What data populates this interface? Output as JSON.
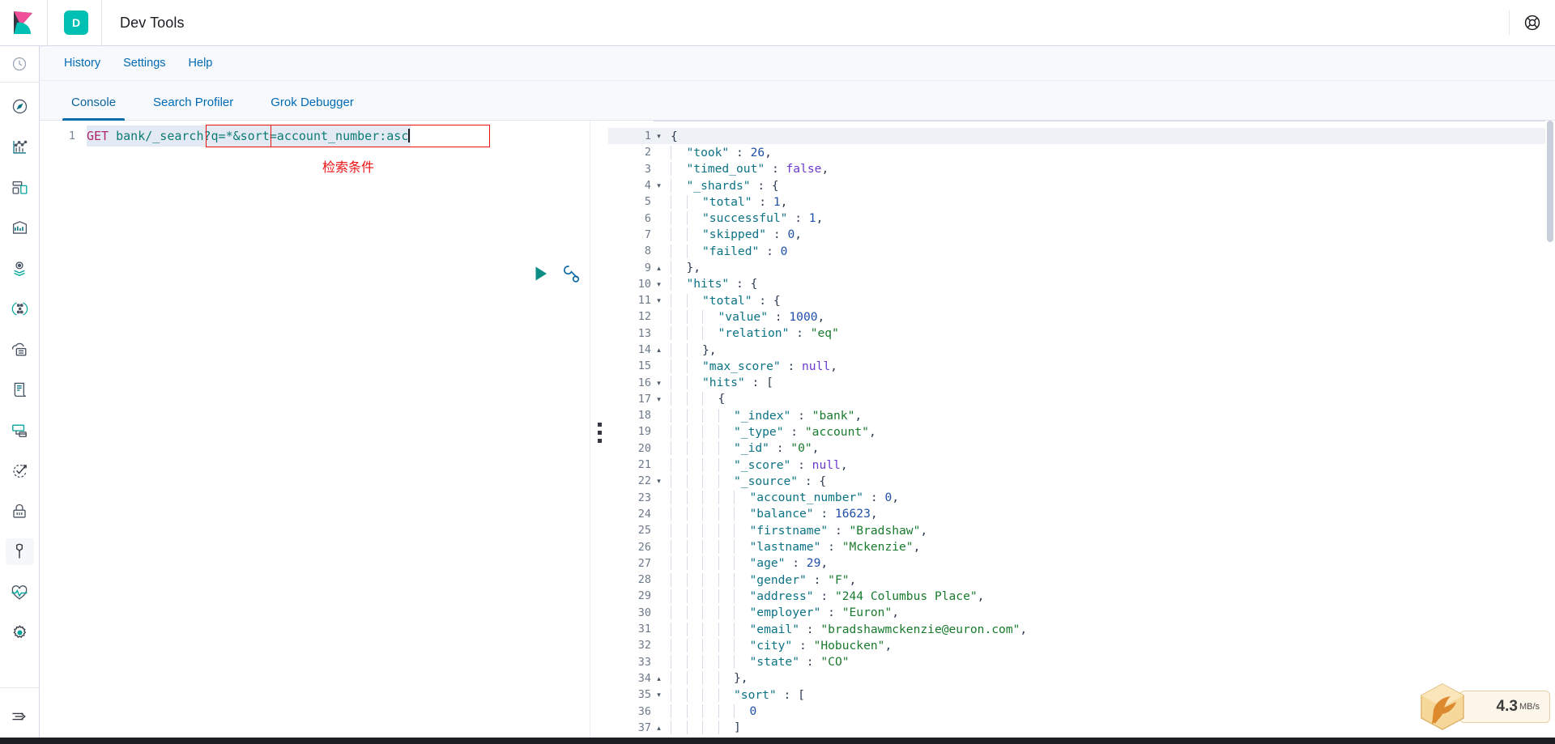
{
  "header": {
    "app_badge": "D",
    "title": "Dev Tools",
    "logo_name": "kibana-logo",
    "help_icon": "help-lifebuoy-icon"
  },
  "menu": {
    "items": [
      {
        "label": "History"
      },
      {
        "label": "Settings"
      },
      {
        "label": "Help"
      }
    ]
  },
  "tabs": {
    "items": [
      {
        "label": "Console",
        "active": true
      },
      {
        "label": "Search Profiler",
        "active": false
      },
      {
        "label": "Grok Debugger",
        "active": false
      }
    ]
  },
  "sidebar": {
    "items": [
      {
        "name": "recently-viewed-icon",
        "icon": "clock"
      },
      {
        "name": "discover-icon",
        "icon": "compass"
      },
      {
        "name": "visualize-icon",
        "icon": "chart"
      },
      {
        "name": "dashboard-icon",
        "icon": "dashboard"
      },
      {
        "name": "canvas-icon",
        "icon": "canvas"
      },
      {
        "name": "maps-icon",
        "icon": "map-pin-layers"
      },
      {
        "name": "graph-icon",
        "icon": "graph-nodes"
      },
      {
        "name": "machine-learning-icon",
        "icon": "ml-cloud"
      },
      {
        "name": "logs-icon",
        "icon": "logs-document"
      },
      {
        "name": "infrastructure-icon",
        "icon": "infrastructure"
      },
      {
        "name": "uptime-icon",
        "icon": "uptime-check"
      },
      {
        "name": "siem-icon",
        "icon": "lock"
      },
      {
        "name": "dev-tools-icon",
        "icon": "wrench",
        "active": true
      },
      {
        "name": "monitoring-icon",
        "icon": "heartbeat"
      },
      {
        "name": "management-icon",
        "icon": "gear"
      },
      {
        "name": "collapse-nav-icon",
        "icon": "arrow-collapse"
      }
    ]
  },
  "editor": {
    "line_number": "1",
    "method": "GET",
    "path_base": "bank",
    "path_search": "/_search",
    "query_string": "?q=*&sort=account_number:asc",
    "annotation_cn": "检索条件",
    "run_button_name": "send-request-play-button",
    "wrench_button_name": "request-options-wrench-button"
  },
  "output": {
    "lines": [
      {
        "no": "1",
        "fold": "▾",
        "indent": 0,
        "tokens": [
          [
            "p",
            "{"
          ]
        ]
      },
      {
        "no": "2",
        "fold": "",
        "indent": 1,
        "tokens": [
          [
            "k",
            "\"took\""
          ],
          [
            "p",
            " : "
          ],
          [
            "n",
            "26"
          ],
          [
            "p",
            ","
          ]
        ]
      },
      {
        "no": "3",
        "fold": "",
        "indent": 1,
        "tokens": [
          [
            "k",
            "\"timed_out\""
          ],
          [
            "p",
            " : "
          ],
          [
            "b",
            "false"
          ],
          [
            "p",
            ","
          ]
        ]
      },
      {
        "no": "4",
        "fold": "▾",
        "indent": 1,
        "tokens": [
          [
            "k",
            "\"_shards\""
          ],
          [
            "p",
            " : {"
          ]
        ]
      },
      {
        "no": "5",
        "fold": "",
        "indent": 2,
        "tokens": [
          [
            "k",
            "\"total\""
          ],
          [
            "p",
            " : "
          ],
          [
            "n",
            "1"
          ],
          [
            "p",
            ","
          ]
        ]
      },
      {
        "no": "6",
        "fold": "",
        "indent": 2,
        "tokens": [
          [
            "k",
            "\"successful\""
          ],
          [
            "p",
            " : "
          ],
          [
            "n",
            "1"
          ],
          [
            "p",
            ","
          ]
        ]
      },
      {
        "no": "7",
        "fold": "",
        "indent": 2,
        "tokens": [
          [
            "k",
            "\"skipped\""
          ],
          [
            "p",
            " : "
          ],
          [
            "n",
            "0"
          ],
          [
            "p",
            ","
          ]
        ]
      },
      {
        "no": "8",
        "fold": "",
        "indent": 2,
        "tokens": [
          [
            "k",
            "\"failed\""
          ],
          [
            "p",
            " : "
          ],
          [
            "n",
            "0"
          ]
        ]
      },
      {
        "no": "9",
        "fold": "▴",
        "indent": 1,
        "tokens": [
          [
            "p",
            "},"
          ]
        ]
      },
      {
        "no": "10",
        "fold": "▾",
        "indent": 1,
        "tokens": [
          [
            "k",
            "\"hits\""
          ],
          [
            "p",
            " : {"
          ]
        ]
      },
      {
        "no": "11",
        "fold": "▾",
        "indent": 2,
        "tokens": [
          [
            "k",
            "\"total\""
          ],
          [
            "p",
            " : {"
          ]
        ]
      },
      {
        "no": "12",
        "fold": "",
        "indent": 3,
        "tokens": [
          [
            "k",
            "\"value\""
          ],
          [
            "p",
            " : "
          ],
          [
            "n",
            "1000"
          ],
          [
            "p",
            ","
          ]
        ]
      },
      {
        "no": "13",
        "fold": "",
        "indent": 3,
        "tokens": [
          [
            "k",
            "\"relation\""
          ],
          [
            "p",
            " : "
          ],
          [
            "s",
            "\"eq\""
          ]
        ]
      },
      {
        "no": "14",
        "fold": "▴",
        "indent": 2,
        "tokens": [
          [
            "p",
            "},"
          ]
        ]
      },
      {
        "no": "15",
        "fold": "",
        "indent": 2,
        "tokens": [
          [
            "k",
            "\"max_score\""
          ],
          [
            "p",
            " : "
          ],
          [
            "b",
            "null"
          ],
          [
            "p",
            ","
          ]
        ]
      },
      {
        "no": "16",
        "fold": "▾",
        "indent": 2,
        "tokens": [
          [
            "k",
            "\"hits\""
          ],
          [
            "p",
            " : ["
          ]
        ]
      },
      {
        "no": "17",
        "fold": "▾",
        "indent": 3,
        "tokens": [
          [
            "p",
            "{"
          ]
        ]
      },
      {
        "no": "18",
        "fold": "",
        "indent": 4,
        "tokens": [
          [
            "k",
            "\"_index\""
          ],
          [
            "p",
            " : "
          ],
          [
            "s",
            "\"bank\""
          ],
          [
            "p",
            ","
          ]
        ]
      },
      {
        "no": "19",
        "fold": "",
        "indent": 4,
        "tokens": [
          [
            "k",
            "\"_type\""
          ],
          [
            "p",
            " : "
          ],
          [
            "s",
            "\"account\""
          ],
          [
            "p",
            ","
          ]
        ]
      },
      {
        "no": "20",
        "fold": "",
        "indent": 4,
        "tokens": [
          [
            "k",
            "\"_id\""
          ],
          [
            "p",
            " : "
          ],
          [
            "s",
            "\"0\""
          ],
          [
            "p",
            ","
          ]
        ]
      },
      {
        "no": "21",
        "fold": "",
        "indent": 4,
        "tokens": [
          [
            "k",
            "\"_score\""
          ],
          [
            "p",
            " : "
          ],
          [
            "b",
            "null"
          ],
          [
            "p",
            ","
          ]
        ]
      },
      {
        "no": "22",
        "fold": "▾",
        "indent": 4,
        "tokens": [
          [
            "k",
            "\"_source\""
          ],
          [
            "p",
            " : {"
          ]
        ]
      },
      {
        "no": "23",
        "fold": "",
        "indent": 5,
        "tokens": [
          [
            "k",
            "\"account_number\""
          ],
          [
            "p",
            " : "
          ],
          [
            "n",
            "0"
          ],
          [
            "p",
            ","
          ]
        ]
      },
      {
        "no": "24",
        "fold": "",
        "indent": 5,
        "tokens": [
          [
            "k",
            "\"balance\""
          ],
          [
            "p",
            " : "
          ],
          [
            "n",
            "16623"
          ],
          [
            "p",
            ","
          ]
        ]
      },
      {
        "no": "25",
        "fold": "",
        "indent": 5,
        "tokens": [
          [
            "k",
            "\"firstname\""
          ],
          [
            "p",
            " : "
          ],
          [
            "s",
            "\"Bradshaw\""
          ],
          [
            "p",
            ","
          ]
        ]
      },
      {
        "no": "26",
        "fold": "",
        "indent": 5,
        "tokens": [
          [
            "k",
            "\"lastname\""
          ],
          [
            "p",
            " : "
          ],
          [
            "s",
            "\"Mckenzie\""
          ],
          [
            "p",
            ","
          ]
        ]
      },
      {
        "no": "27",
        "fold": "",
        "indent": 5,
        "tokens": [
          [
            "k",
            "\"age\""
          ],
          [
            "p",
            " : "
          ],
          [
            "n",
            "29"
          ],
          [
            "p",
            ","
          ]
        ]
      },
      {
        "no": "28",
        "fold": "",
        "indent": 5,
        "tokens": [
          [
            "k",
            "\"gender\""
          ],
          [
            "p",
            " : "
          ],
          [
            "s",
            "\"F\""
          ],
          [
            "p",
            ","
          ]
        ]
      },
      {
        "no": "29",
        "fold": "",
        "indent": 5,
        "tokens": [
          [
            "k",
            "\"address\""
          ],
          [
            "p",
            " : "
          ],
          [
            "s",
            "\"244 Columbus Place\""
          ],
          [
            "p",
            ","
          ]
        ]
      },
      {
        "no": "30",
        "fold": "",
        "indent": 5,
        "tokens": [
          [
            "k",
            "\"employer\""
          ],
          [
            "p",
            " : "
          ],
          [
            "s",
            "\"Euron\""
          ],
          [
            "p",
            ","
          ]
        ]
      },
      {
        "no": "31",
        "fold": "",
        "indent": 5,
        "tokens": [
          [
            "k",
            "\"email\""
          ],
          [
            "p",
            " : "
          ],
          [
            "s",
            "\"bradshawmckenzie@euron.com\""
          ],
          [
            "p",
            ","
          ]
        ]
      },
      {
        "no": "32",
        "fold": "",
        "indent": 5,
        "tokens": [
          [
            "k",
            "\"city\""
          ],
          [
            "p",
            " : "
          ],
          [
            "s",
            "\"Hobucken\""
          ],
          [
            "p",
            ","
          ]
        ]
      },
      {
        "no": "33",
        "fold": "",
        "indent": 5,
        "tokens": [
          [
            "k",
            "\"state\""
          ],
          [
            "p",
            " : "
          ],
          [
            "s",
            "\"CO\""
          ]
        ]
      },
      {
        "no": "34",
        "fold": "▴",
        "indent": 4,
        "tokens": [
          [
            "p",
            "},"
          ]
        ]
      },
      {
        "no": "35",
        "fold": "▾",
        "indent": 4,
        "tokens": [
          [
            "k",
            "\"sort\""
          ],
          [
            "p",
            " : ["
          ]
        ]
      },
      {
        "no": "36",
        "fold": "",
        "indent": 5,
        "tokens": [
          [
            "n",
            "0"
          ]
        ]
      },
      {
        "no": "37",
        "fold": "▴",
        "indent": 4,
        "tokens": [
          [
            "p",
            "]"
          ]
        ]
      }
    ]
  },
  "download_widget": {
    "speed": "4.3",
    "unit": "MB/s",
    "icon_name": "hummingbird-hexagon-icon"
  },
  "colors": {
    "accent_teal": "#00BFB3",
    "link_blue": "#006bb4",
    "annotation_red": "#ee1111",
    "method_pink": "#b0256d",
    "url_teal": "#0c7b74"
  }
}
